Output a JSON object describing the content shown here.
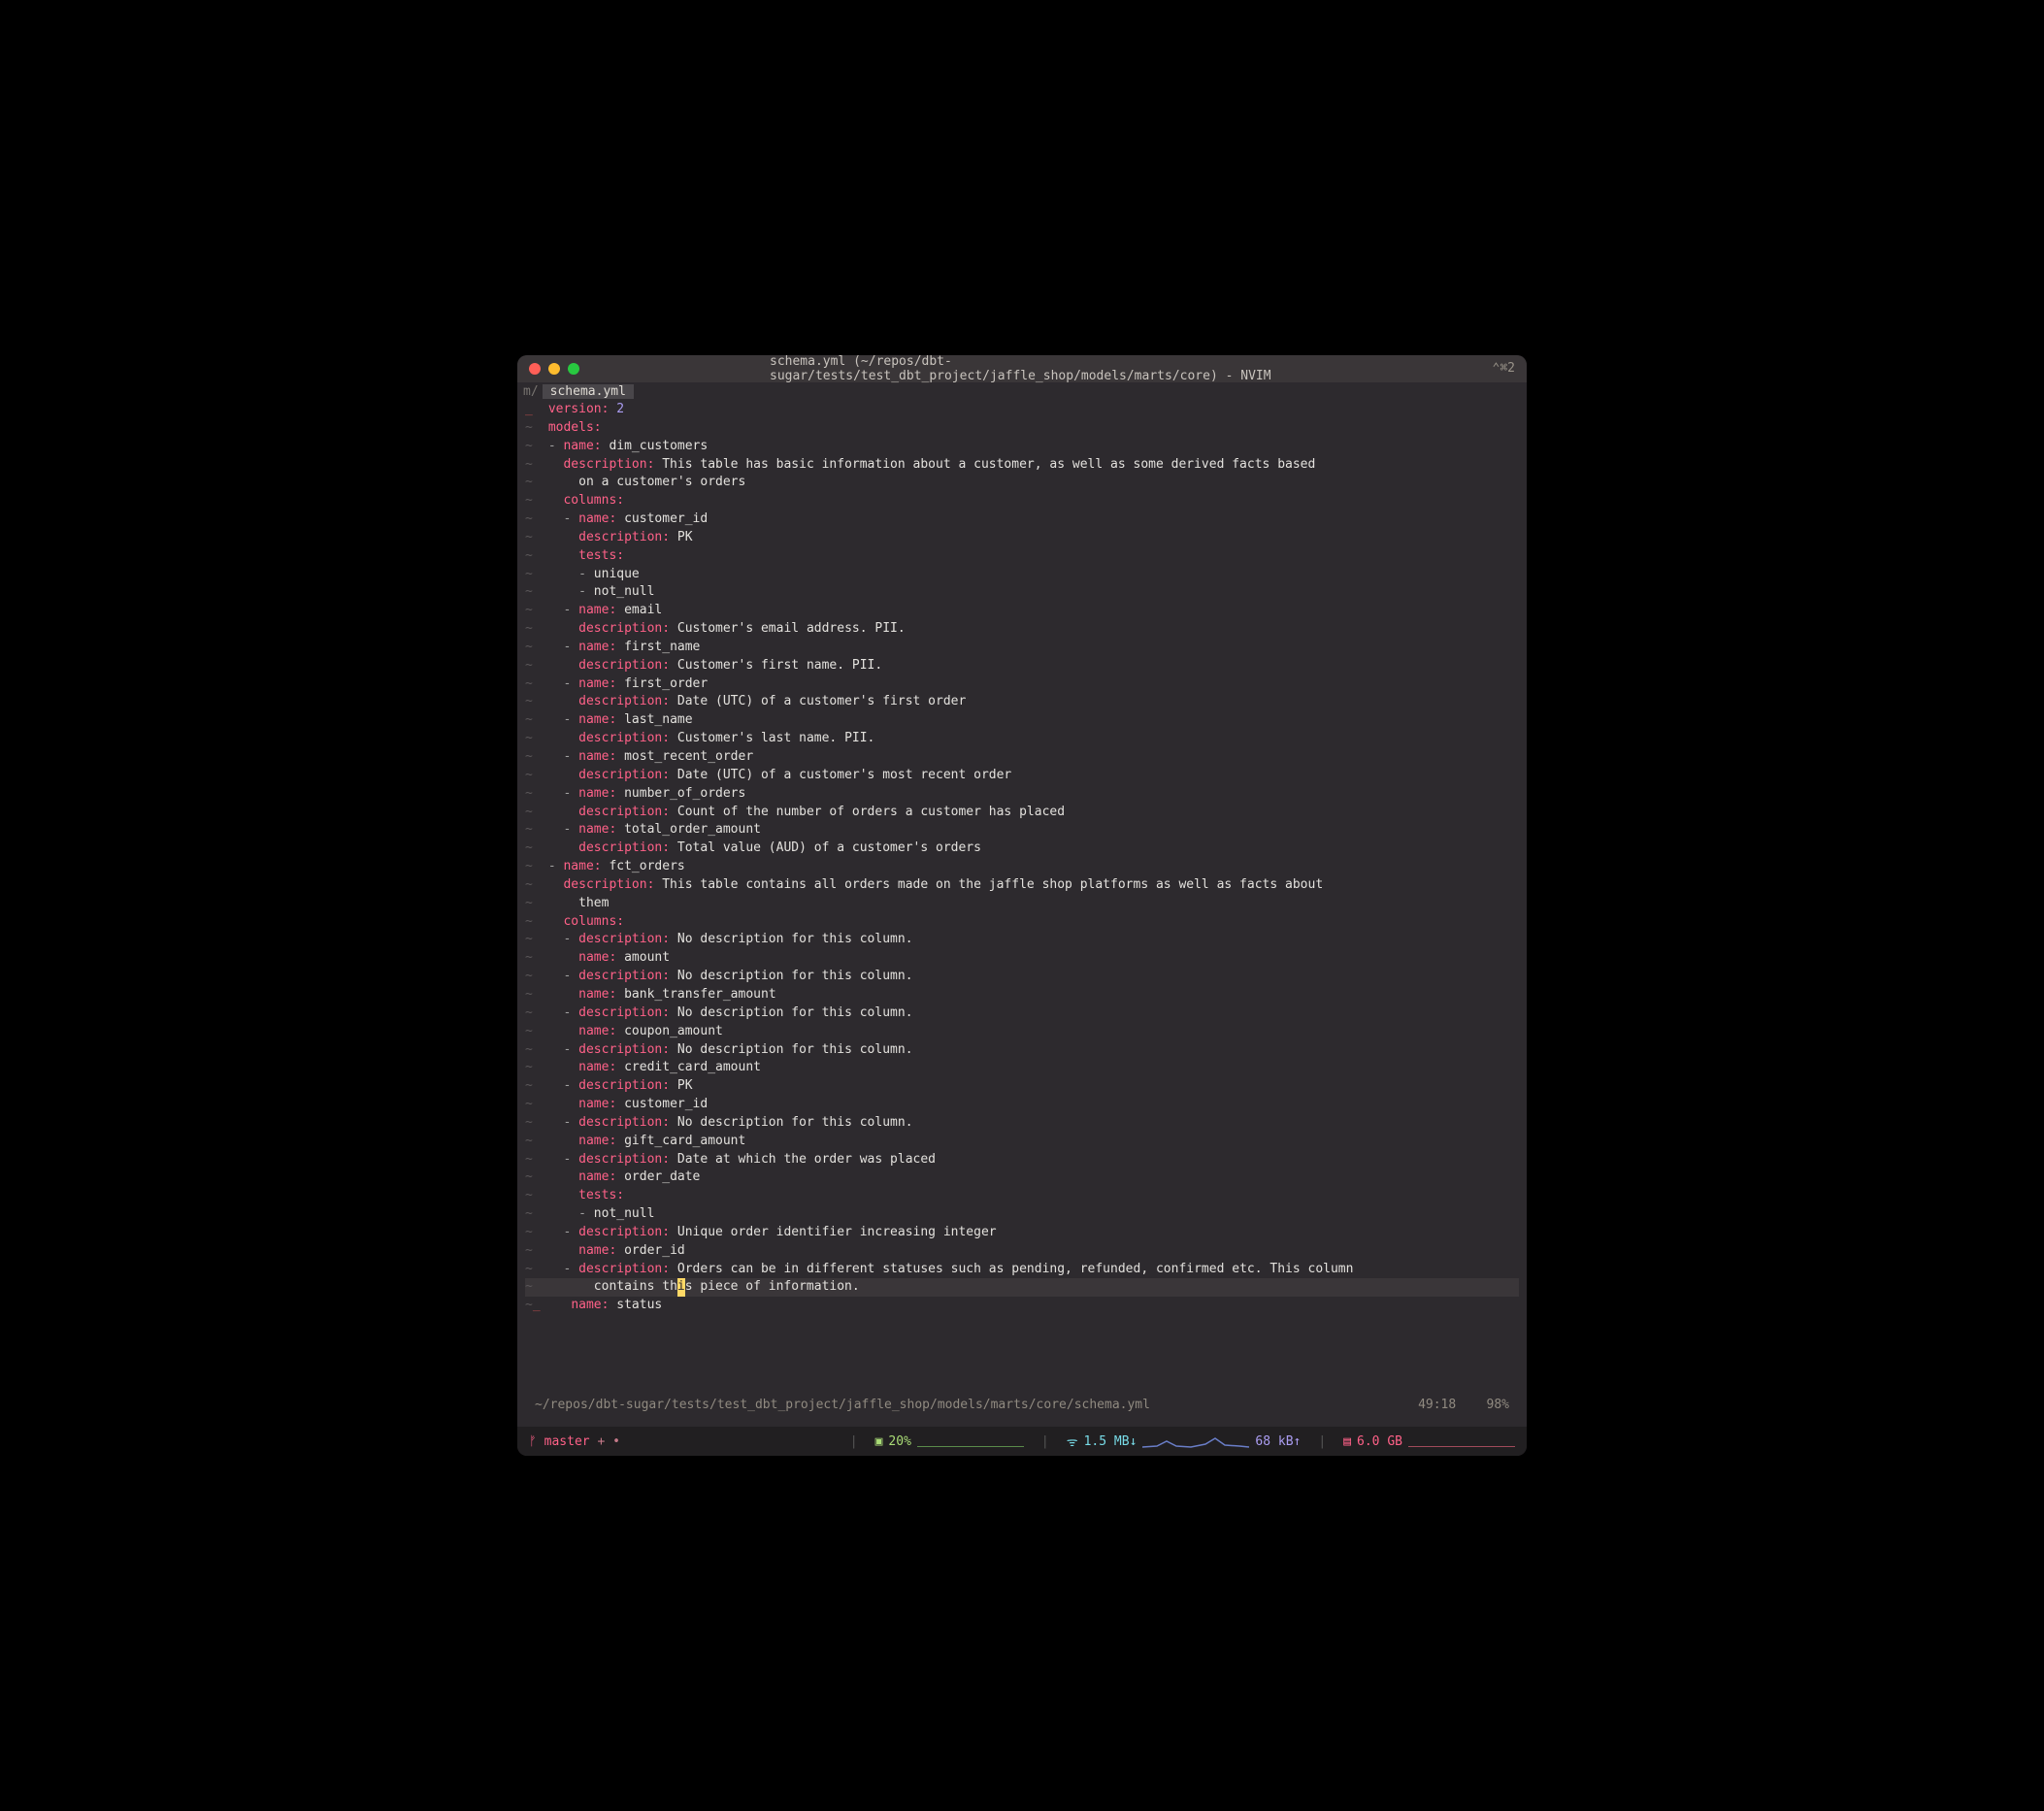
{
  "window": {
    "title": "schema.yml (~/repos/dbt-sugar/tests/test_dbt_project/jaffle_shop/models/marts/core) - NVIM",
    "shortcut": "⌃⌘2"
  },
  "tabs": {
    "prefix": "m/",
    "active": " schema.yml "
  },
  "yaml": {
    "version_key": "version",
    "version_val": "2",
    "models_key": "models",
    "m1": {
      "name_key": "name",
      "name_val": "dim_customers",
      "desc_key": "description",
      "desc_val": "This table has basic information about a customer, as well as some derived facts based",
      "desc_cont": "on a customer's orders",
      "columns_key": "columns",
      "c1": {
        "name_key": "name",
        "name_val": "customer_id",
        "desc_key": "description",
        "desc_val": "PK",
        "tests_key": "tests",
        "t1": "unique",
        "t2": "not_null"
      },
      "c2": {
        "name_key": "name",
        "name_val": "email",
        "desc_key": "description",
        "desc_val": "Customer's email address. PII."
      },
      "c3": {
        "name_key": "name",
        "name_val": "first_name",
        "desc_key": "description",
        "desc_val": "Customer's first name. PII."
      },
      "c4": {
        "name_key": "name",
        "name_val": "first_order",
        "desc_key": "description",
        "desc_val": "Date (UTC) of a customer's first order"
      },
      "c5": {
        "name_key": "name",
        "name_val": "last_name",
        "desc_key": "description",
        "desc_val": "Customer's last name. PII."
      },
      "c6": {
        "name_key": "name",
        "name_val": "most_recent_order",
        "desc_key": "description",
        "desc_val": "Date (UTC) of a customer's most recent order"
      },
      "c7": {
        "name_key": "name",
        "name_val": "number_of_orders",
        "desc_key": "description",
        "desc_val": "Count of the number of orders a customer has placed"
      },
      "c8": {
        "name_key": "name",
        "name_val": "total_order_amount",
        "desc_key": "description",
        "desc_val": "Total value (AUD) of a customer's orders"
      }
    },
    "m2": {
      "name_key": "name",
      "name_val": "fct_orders",
      "desc_key": "description",
      "desc_val": "This table contains all orders made on the jaffle shop platforms as well as facts about",
      "desc_cont": "them",
      "columns_key": "columns",
      "c1": {
        "desc_key": "description",
        "desc_val": "No description for this column.",
        "name_key": "name",
        "name_val": "amount"
      },
      "c2": {
        "desc_key": "description",
        "desc_val": "No description for this column.",
        "name_key": "name",
        "name_val": "bank_transfer_amount"
      },
      "c3": {
        "desc_key": "description",
        "desc_val": "No description for this column.",
        "name_key": "name",
        "name_val": "coupon_amount"
      },
      "c4": {
        "desc_key": "description",
        "desc_val": "No description for this column.",
        "name_key": "name",
        "name_val": "credit_card_amount"
      },
      "c5": {
        "desc_key": "description",
        "desc_val": "PK",
        "name_key": "name",
        "name_val": "customer_id"
      },
      "c6": {
        "desc_key": "description",
        "desc_val": "No description for this column.",
        "name_key": "name",
        "name_val": "gift_card_amount"
      },
      "c7": {
        "desc_key": "description",
        "desc_val": "Date at which the order was placed",
        "name_key": "name",
        "name_val": "order_date",
        "tests_key": "tests",
        "t1": "not_null"
      },
      "c8": {
        "desc_key": "description",
        "desc_val": "Unique order identifier increasing integer",
        "name_key": "name",
        "name_val": "order_id"
      },
      "c9": {
        "desc_key": "description",
        "desc_val": "Orders can be in different statuses such as pending, refunded, confirmed etc. This column",
        "desc_cont_pre": "contains th",
        "desc_cont_cursor": "i",
        "desc_cont_post": "s piece of information.",
        "name_key": "name",
        "name_val": "status"
      }
    }
  },
  "status": {
    "path": "~/repos/dbt-sugar/tests/test_dbt_project/jaffle_shop/models/marts/core/schema.yml",
    "pos": "49:18",
    "pct": "98%"
  },
  "bottom": {
    "branch_icon": "ᚠ",
    "branch": "master",
    "branch_suffix": "+ •",
    "cpu_icon": "▣",
    "cpu": "20%",
    "net_icon": "ᯤ",
    "net_down": "1.5 MB↓",
    "net_up": "68 kB↑",
    "mem_icon": "▤",
    "mem": "6.0 GB"
  }
}
